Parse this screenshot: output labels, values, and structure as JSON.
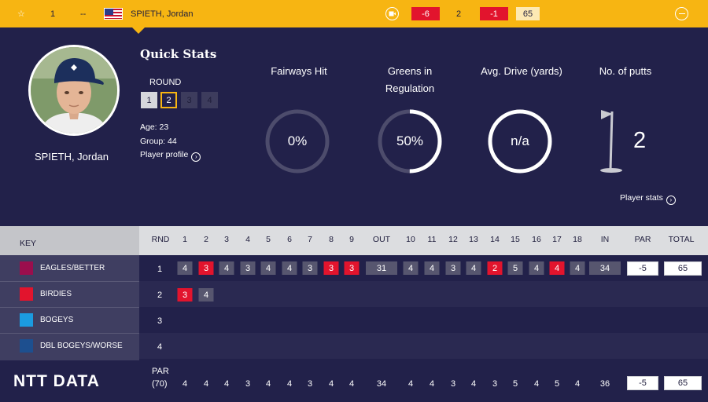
{
  "topbar": {
    "position": "1",
    "movement": "--",
    "player_name": "SPIETH, Jordan",
    "to_par": "-6",
    "thru": "2",
    "today": "-1",
    "total": "65",
    "icons": [
      "star-icon",
      "flag-usa-icon",
      "scorecard-icon",
      "collapse-icon"
    ]
  },
  "profile": {
    "name": "SPIETH, Jordan",
    "age_label": "Age: 23",
    "group_label": "Group: 44",
    "profile_link": "Player profile"
  },
  "quick_stats": {
    "title": "Quick Stats",
    "round_label": "ROUND",
    "rounds": [
      "1",
      "2",
      "3",
      "4"
    ],
    "selected_round": "2",
    "stats": [
      {
        "title": "Fairways Hit",
        "value": "0%",
        "fill": 0
      },
      {
        "title": "Greens in Regulation",
        "value": "50%",
        "fill": 0.5
      },
      {
        "title": "Avg. Drive (yards)",
        "value": "n/a",
        "fill": 1
      },
      {
        "title": "No. of putts",
        "value": "2"
      }
    ],
    "player_stats_link": "Player stats"
  },
  "scorecard": {
    "key_title": "KEY",
    "key": [
      {
        "label": "EAGLES/BETTER",
        "color": "#9b0e4d"
      },
      {
        "label": "BIRDIES",
        "color": "#e2142d"
      },
      {
        "label": "BOGEYS",
        "color": "#1b9be0"
      },
      {
        "label": "DBL BOGEYS/WORSE",
        "color": "#1d4f8f"
      }
    ],
    "headers": {
      "rnd": "RND",
      "holes_front": [
        "1",
        "2",
        "3",
        "4",
        "5",
        "6",
        "7",
        "8",
        "9"
      ],
      "out": "OUT",
      "holes_back": [
        "10",
        "11",
        "12",
        "13",
        "14",
        "15",
        "16",
        "17",
        "18"
      ],
      "in": "IN",
      "par": "PAR",
      "total": "TOTAL"
    },
    "rounds": [
      {
        "rnd": "1",
        "front": [
          "4",
          "3",
          "4",
          "3",
          "4",
          "4",
          "3",
          "3",
          "3"
        ],
        "front_birdie": [
          false,
          true,
          false,
          false,
          false,
          false,
          false,
          true,
          true
        ],
        "out": "31",
        "back": [
          "4",
          "4",
          "3",
          "4",
          "2",
          "5",
          "4",
          "4",
          "4"
        ],
        "back_birdie": [
          false,
          false,
          false,
          false,
          true,
          false,
          false,
          true,
          false
        ],
        "in": "34",
        "par": "-5",
        "total": "65"
      },
      {
        "rnd": "2",
        "front": [
          "3",
          "4"
        ],
        "front_birdie": [
          true,
          false
        ]
      },
      {
        "rnd": "3"
      },
      {
        "rnd": "4"
      }
    ],
    "par_label_1": "PAR",
    "par_label_2": "(70)",
    "par_front": [
      "4",
      "4",
      "4",
      "3",
      "4",
      "4",
      "3",
      "4",
      "4"
    ],
    "par_out": "34",
    "par_back": [
      "4",
      "4",
      "3",
      "4",
      "3",
      "5",
      "4",
      "5",
      "4"
    ],
    "par_in": "36",
    "par_par": "-5",
    "par_total": "65"
  },
  "brand": "NTT DATA",
  "colors": {
    "background": "#22214a",
    "accent": "#f7b512",
    "birdie": "#e2142d",
    "score_cell": "#57566f"
  }
}
